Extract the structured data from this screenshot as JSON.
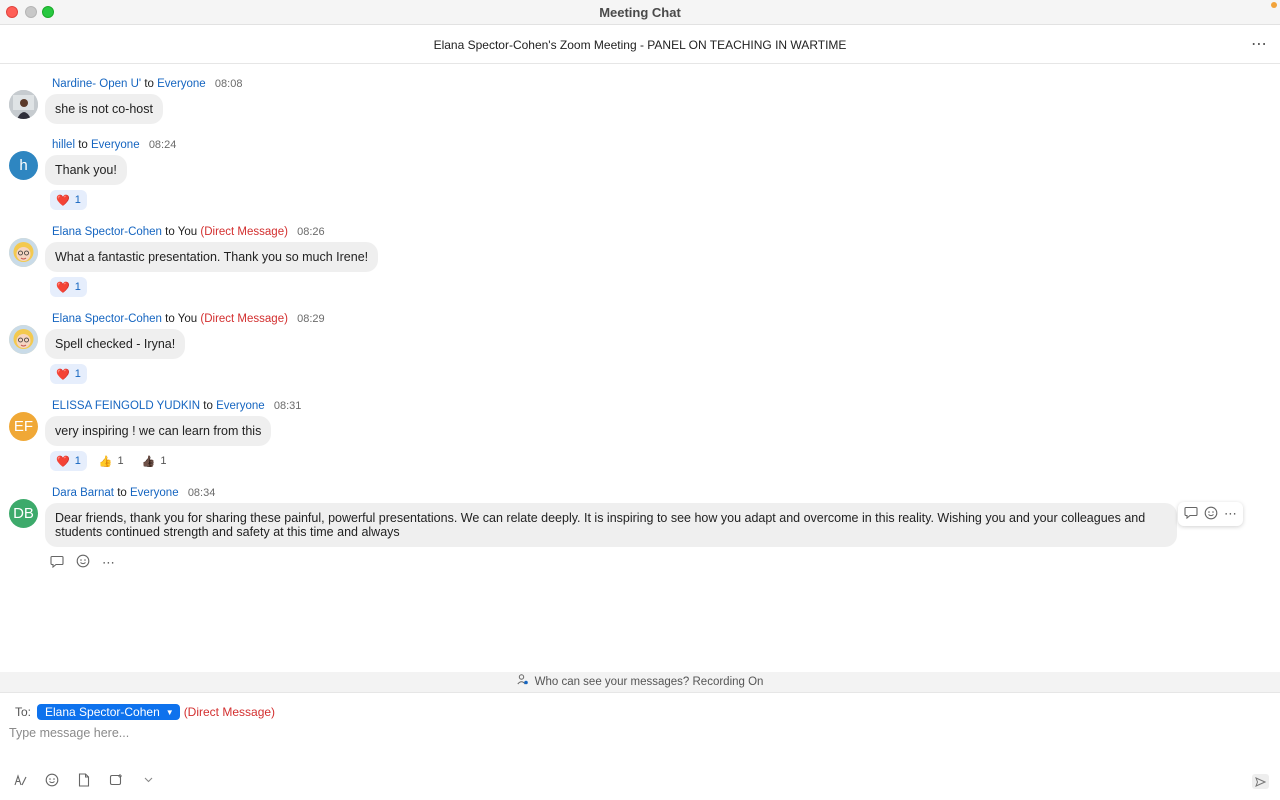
{
  "window": {
    "title": "Meeting Chat"
  },
  "header": {
    "meeting_title": "Elana Spector-Cohen's Zoom Meeting - PANEL ON TEACHING IN WARTIME",
    "more_icon": "ellipsis-icon"
  },
  "colors": {
    "link_blue": "#1565c0",
    "dm_red": "#d32f2f",
    "pill_blue": "#0e72ed"
  },
  "messages": [
    {
      "sender": "Nardine- Open U'",
      "to_word": "to",
      "recipient": "Everyone",
      "dm": "",
      "time": "08:08",
      "text": "she is not co-host",
      "avatar": {
        "initials": "",
        "color": "#9aa3a8"
      },
      "reactions": []
    },
    {
      "sender": "hillel",
      "to_word": "to",
      "recipient": "Everyone",
      "dm": "",
      "time": "08:24",
      "text": "Thank you!",
      "avatar": {
        "initials": "h",
        "color": "#2e86c1"
      },
      "reactions": [
        {
          "emoji": "❤️",
          "count": "1"
        }
      ]
    },
    {
      "sender": "Elana Spector-Cohen",
      "to_word": "to",
      "recipient": "You",
      "dm": "(Direct Message)",
      "time": "08:26",
      "text": "What a fantastic presentation. Thank you so much Irene!",
      "avatar": {
        "initials": "",
        "color": "#f6d38a"
      },
      "reactions": [
        {
          "emoji": "❤️",
          "count": "1"
        }
      ]
    },
    {
      "sender": "Elana Spector-Cohen",
      "to_word": "to",
      "recipient": "You",
      "dm": "(Direct Message)",
      "time": "08:29",
      "text": "Spell checked - Iryna!",
      "avatar": {
        "initials": "",
        "color": "#f6d38a"
      },
      "reactions": [
        {
          "emoji": "❤️",
          "count": "1"
        }
      ]
    },
    {
      "sender": "ELISSA FEINGOLD YUDKIN",
      "to_word": "to",
      "recipient": "Everyone",
      "dm": "",
      "time": "08:31",
      "text": "very inspiring ! we can learn from this",
      "avatar": {
        "initials": "EF",
        "color": "#f0a836"
      },
      "reactions": [
        {
          "emoji": "❤️",
          "count": "1"
        },
        {
          "emoji": "👍",
          "count": "1"
        },
        {
          "emoji": "👍🏿",
          "count": "1"
        }
      ]
    },
    {
      "sender": "Dara Barnat",
      "to_word": "to",
      "recipient": "Everyone",
      "dm": "",
      "time": "08:34",
      "text": "Dear friends, thank you for sharing these painful, powerful presentations. We can relate deeply. It is inspiring to see how you adapt and overcome in this reality. Wishing you and your colleagues and students continued strength and safety at this time and always",
      "avatar": {
        "initials": "DB",
        "color": "#3daa6b"
      },
      "reactions": []
    }
  ],
  "message_actions": {
    "reply_icon": "reply-icon",
    "emoji_icon": "add-reaction-icon",
    "more_icon": "more-icon"
  },
  "notice": {
    "text": "Who can see your messages? Recording On",
    "icon": "people-lock-icon"
  },
  "compose": {
    "to_label": "To:",
    "recipient": "Elana Spector-Cohen",
    "dm_label": "(Direct Message)",
    "placeholder": "Type message here..."
  },
  "toolbar": {
    "icons": [
      "format-icon",
      "emoji-icon",
      "file-icon",
      "screenshot-icon",
      "chevron-down-icon"
    ],
    "send_icon": "send-icon"
  }
}
